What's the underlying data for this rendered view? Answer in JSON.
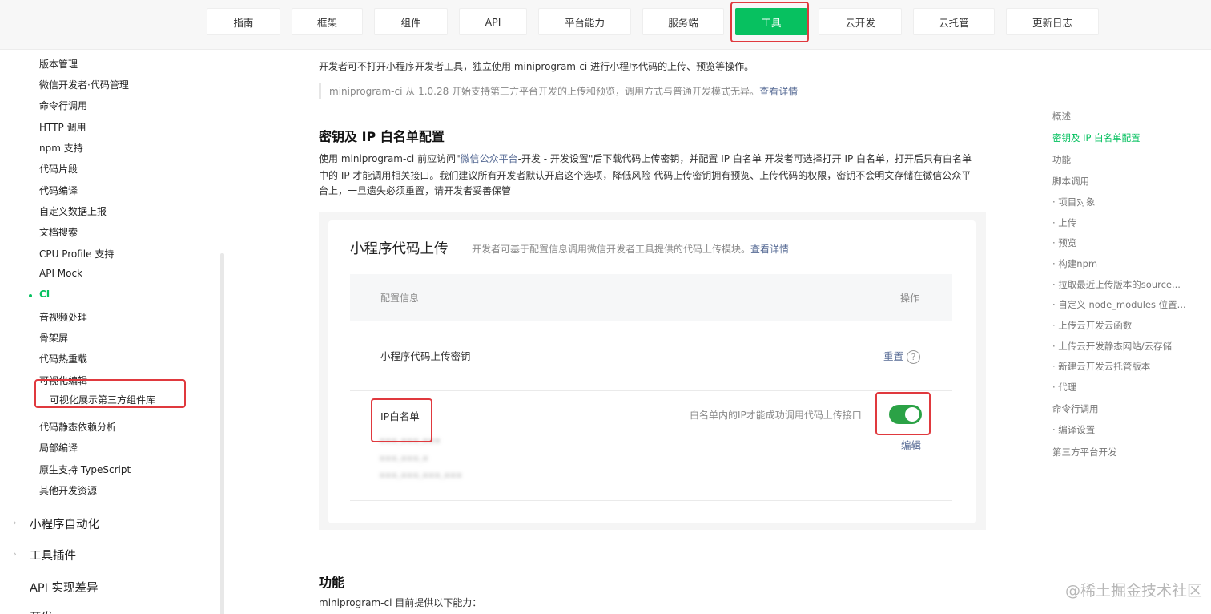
{
  "topnav": {
    "items": [
      "指南",
      "框架",
      "组件",
      "API",
      "平台能力",
      "服务端",
      "工具",
      "云开发",
      "云托管",
      "更新日志"
    ],
    "active": "工具"
  },
  "sidebar": {
    "items": [
      "版本管理",
      "微信开发者·代码管理",
      "命令行调用",
      "HTTP 调用",
      "npm 支持",
      "代码片段",
      "代码编译",
      "自定义数据上报",
      "文档搜索",
      "CPU Profile 支持",
      "API Mock",
      "CI",
      "音视频处理",
      "骨架屏",
      "代码热重载",
      "可视化编辑"
    ],
    "active": "CI",
    "sub_item": "可视化展示第三方组件库",
    "items_after": [
      "代码静态依赖分析",
      "局部编译",
      "原生支持 TypeScript",
      "其他开发资源"
    ],
    "groups": [
      "小程序自动化",
      "工具插件",
      "API 实现差异"
    ],
    "cut_off": "开发"
  },
  "main": {
    "intro": "开发者可不打开小程序开发者工具，独立使用 miniprogram-ci 进行小程序代码的上传、预览等操作。",
    "quote_text": "miniprogram-ci 从 1.0.28 开始支持第三方平台开发的上传和预览，调用方式与普通开发模式无异。",
    "quote_link": "查看详情",
    "section_title": "密钥及 IP 白名单配置",
    "para_1a": "使用 miniprogram-ci 前应访问\"",
    "para_1_link": "微信公众平台",
    "para_1b": "-开发 - 开发设置\"后下载代码上传密钥，并配置 IP 白名单 开发者可选择打开 IP 白名单，打开后只有白名单",
    "para_2": "中的 IP 才能调用相关接口。我们建议所有开发者默认开启这个选项，降低风险 代码上传密钥拥有预览、上传代码的权限，密钥不会明文存储在微信公众平",
    "para_3": "台上，一旦遗失必须重置，请开发者妥善保管",
    "card": {
      "title": "小程序代码上传",
      "desc": "开发者可基于配置信息调用微信开发者工具提供的代码上传模块。",
      "desc_link": "查看详情",
      "col_config": "配置信息",
      "col_action": "操作",
      "row1_label": "小程序代码上传密钥",
      "row1_action": "重置",
      "row1_help": "?",
      "row2_label": "IP白名单",
      "row2_hint": "白名单内的IP才能成功调用代码上传接口",
      "row2_edit": "编辑",
      "toggle_on": true,
      "ip_list": [
        "•••.•••.•••",
        "•••.•••.•",
        "•••.•••.•••.•••"
      ]
    },
    "section2_title": "功能",
    "section2_text": "miniprogram-ci 目前提供以下能力："
  },
  "toc": {
    "items": [
      "概述",
      "密钥及 IP 白名单配置",
      "功能",
      "脚本调用",
      "· 项目对象",
      "· 上传",
      "· 预览",
      "· 构建npm",
      "· 拉取最近上传版本的source...",
      "· 自定义 node_modules 位置...",
      "· 上传云开发云函数",
      "· 上传云开发静态网站/云存储",
      "· 新建云开发云托管版本",
      "· 代理",
      "命令行调用",
      "· 编译设置",
      "第三方平台开发"
    ],
    "active": "密钥及 IP 白名单配置"
  },
  "watermark": "@稀土掘金技术社区",
  "colors": {
    "brand": "#07c160",
    "link": "#576b95",
    "highlight": "#e0393e",
    "toggle": "#2ba246"
  }
}
